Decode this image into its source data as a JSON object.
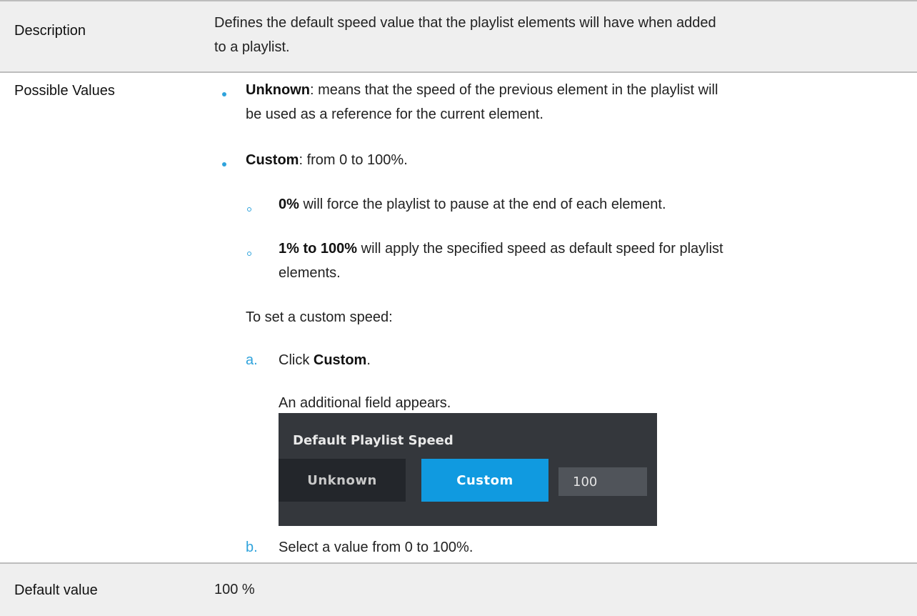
{
  "rows": {
    "description": {
      "label": "Description",
      "text_line1": "Defines the default speed value that the playlist elements will have when added",
      "text_line2": "to a playlist."
    },
    "possible_values": {
      "label": "Possible Values",
      "unknown": {
        "term": "Unknown",
        "rest_line1": ": means that the speed of the previous element in the playlist will",
        "rest_line2": "be used as a reference for the current element."
      },
      "custom": {
        "term": "Custom",
        "rest": ": from 0 to 100%."
      },
      "sub_zero": {
        "term": "0%",
        "rest": " will force the playlist to pause at the end of each element."
      },
      "sub_range": {
        "term": "1% to 100%",
        "rest_line1": " will apply the specified speed as default speed for playlist",
        "rest_line2": "elements."
      },
      "intro": "To set a custom speed:",
      "step_a": {
        "letter": "a.",
        "prefix": "Click ",
        "term": "Custom",
        "suffix": ".",
        "note": "An additional field appears."
      },
      "step_b": {
        "letter": "b.",
        "text": "Select a value from 0 to 100%."
      }
    },
    "default_value": {
      "label": "Default value",
      "value": "100 %"
    }
  },
  "ui_screenshot": {
    "title": "Default Playlist Speed",
    "unknown_label": "Unknown",
    "custom_label": "Custom",
    "speed_value": "100",
    "selected": "Custom"
  },
  "colors": {
    "accent": "#2fa3dc",
    "row_shade": "#efefef",
    "custom_button": "#109ae0",
    "panel_bg": "#34373c"
  }
}
